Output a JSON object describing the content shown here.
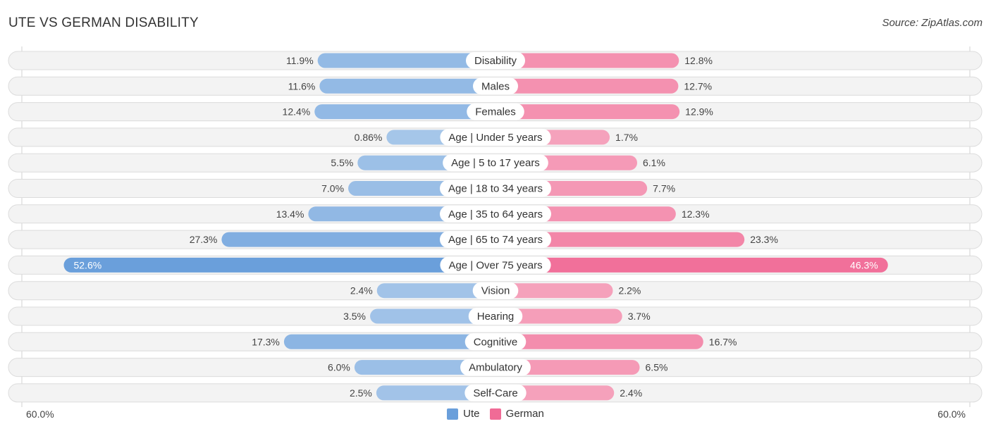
{
  "header": {
    "title": "UTE VS GERMAN DISABILITY",
    "source": "Source: ZipAtlas.com"
  },
  "colors": {
    "ute": "#6a9fdb",
    "ute_light": "#a9c8ea",
    "german": "#f06b96",
    "german_light": "#f6a8c0"
  },
  "chart_data": {
    "type": "bar",
    "orientation": "diverging-horizontal",
    "title": "UTE VS GERMAN DISABILITY",
    "categories": [
      "Disability",
      "Males",
      "Females",
      "Age | Under 5 years",
      "Age | 5 to 17 years",
      "Age | 18 to 34 years",
      "Age | 35 to 64 years",
      "Age | 65 to 74 years",
      "Age | Over 75 years",
      "Vision",
      "Hearing",
      "Cognitive",
      "Ambulatory",
      "Self-Care"
    ],
    "series": [
      {
        "name": "Ute",
        "values": [
          11.9,
          11.6,
          12.4,
          0.86,
          5.5,
          7.0,
          13.4,
          27.3,
          52.6,
          2.4,
          3.5,
          17.3,
          6.0,
          2.5
        ],
        "labels": [
          "11.9%",
          "11.6%",
          "12.4%",
          "0.86%",
          "5.5%",
          "7.0%",
          "13.4%",
          "27.3%",
          "52.6%",
          "2.4%",
          "3.5%",
          "17.3%",
          "6.0%",
          "2.5%"
        ]
      },
      {
        "name": "German",
        "values": [
          12.8,
          12.7,
          12.9,
          1.7,
          6.1,
          7.7,
          12.3,
          23.3,
          46.3,
          2.2,
          3.7,
          16.7,
          6.5,
          2.4
        ],
        "labels": [
          "12.8%",
          "12.7%",
          "12.9%",
          "1.7%",
          "6.1%",
          "7.7%",
          "12.3%",
          "23.3%",
          "46.3%",
          "2.2%",
          "3.7%",
          "16.7%",
          "6.5%",
          "2.4%"
        ]
      }
    ],
    "xlim": [
      -60,
      60
    ],
    "axis_labels": {
      "left": "60.0%",
      "right": "60.0%"
    },
    "legend": {
      "position": "bottom-center",
      "entries": [
        "Ute",
        "German"
      ]
    },
    "grid": false
  }
}
